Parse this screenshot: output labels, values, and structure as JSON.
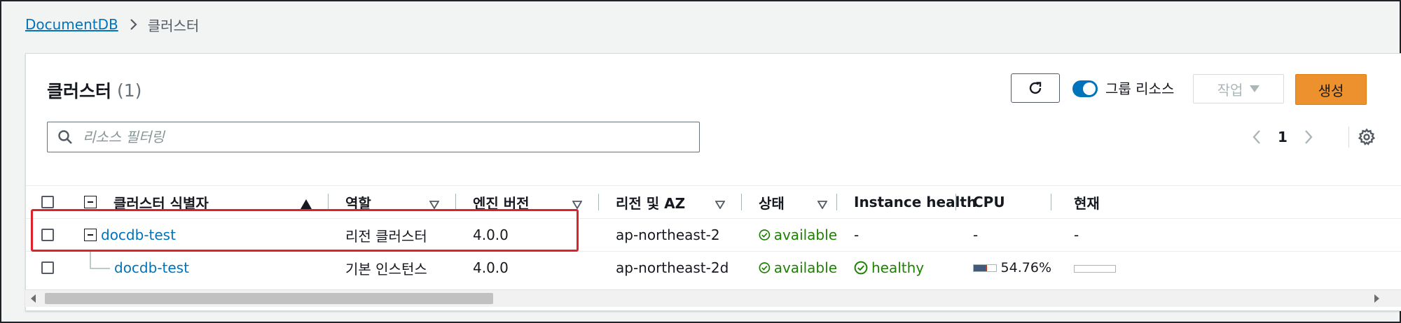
{
  "breadcrumb": {
    "root": "DocumentDB",
    "current": "클러스터"
  },
  "panel": {
    "title": "클러스터",
    "count": "(1)"
  },
  "toolbar": {
    "group_label": "그룹 리소스",
    "group_enabled": true,
    "actions_label": "작업",
    "create_label": "생성"
  },
  "search": {
    "placeholder": "리소스 필터링"
  },
  "pagination": {
    "page": "1"
  },
  "table": {
    "columns": [
      "클러스터 식별자",
      "역할",
      "엔진 버전",
      "리전 및 AZ",
      "상태",
      "Instance health",
      "CPU",
      "현재"
    ],
    "rows": [
      {
        "id": "docdb-test",
        "role": "리전 클러스터",
        "engine": "4.0.0",
        "region": "ap-northeast-2",
        "status": "available",
        "health": "-",
        "cpu": "-",
        "current": "-"
      },
      {
        "id": "docdb-test",
        "role": "기본 인스턴스",
        "engine": "4.0.0",
        "region": "ap-northeast-2d",
        "status": "available",
        "health": "healthy",
        "cpu": "54.76%",
        "cpu_fraction": 0.5476,
        "current": ""
      }
    ]
  },
  "colors": {
    "link": "#0073bb",
    "success": "#1d8102",
    "primary": "#ec912d",
    "highlight": "#e0202b",
    "cpu_fill": "#44597a"
  }
}
